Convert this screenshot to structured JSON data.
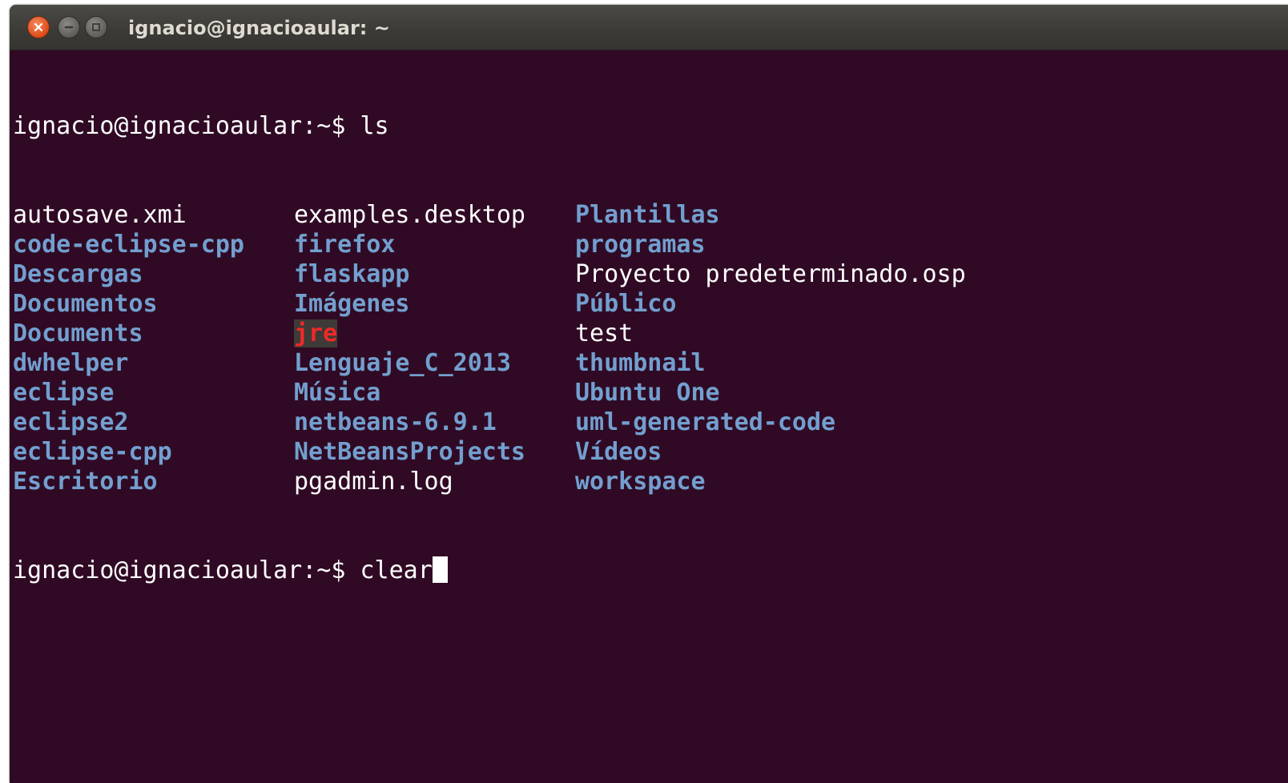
{
  "window": {
    "title": "ignacio@ignacioaular: ~",
    "controls": [
      {
        "name": "close",
        "icon": "close-icon",
        "symbol": "×"
      },
      {
        "name": "minimize",
        "icon": "minimize-icon",
        "symbol": "–"
      },
      {
        "name": "maximize",
        "icon": "maximize-icon",
        "symbol": "□"
      }
    ]
  },
  "colors": {
    "background": "#300a24",
    "directory": "#729fcf",
    "file": "#ffffff",
    "special": "#ef2929"
  },
  "terminal": {
    "prompt": "ignacio@ignacioaular:~$",
    "command1": "ls",
    "listing": [
      [
        {
          "text": "autosave.xmi",
          "type": "file"
        },
        {
          "text": "examples.desktop",
          "type": "file"
        },
        {
          "text": "Plantillas",
          "type": "dir"
        }
      ],
      [
        {
          "text": "code-eclipse-cpp",
          "type": "dir"
        },
        {
          "text": "firefox",
          "type": "dir"
        },
        {
          "text": "programas",
          "type": "dir"
        }
      ],
      [
        {
          "text": "Descargas",
          "type": "dir"
        },
        {
          "text": "flaskapp",
          "type": "dir"
        },
        {
          "text": "Proyecto predeterminado.osp",
          "type": "file"
        }
      ],
      [
        {
          "text": "Documentos",
          "type": "dir"
        },
        {
          "text": "Imágenes",
          "type": "dir"
        },
        {
          "text": "Público",
          "type": "dir"
        }
      ],
      [
        {
          "text": "Documents",
          "type": "dir"
        },
        {
          "text": "jre",
          "type": "special"
        },
        {
          "text": "test",
          "type": "file"
        }
      ],
      [
        {
          "text": "dwhelper",
          "type": "dir"
        },
        {
          "text": "Lenguaje_C_2013",
          "type": "dir"
        },
        {
          "text": "thumbnail",
          "type": "dir"
        }
      ],
      [
        {
          "text": "eclipse",
          "type": "dir"
        },
        {
          "text": "Música",
          "type": "dir"
        },
        {
          "text": "Ubuntu One",
          "type": "dir"
        }
      ],
      [
        {
          "text": "eclipse2",
          "type": "dir"
        },
        {
          "text": "netbeans-6.9.1",
          "type": "dir"
        },
        {
          "text": "uml-generated-code",
          "type": "dir"
        }
      ],
      [
        {
          "text": "eclipse-cpp",
          "type": "dir"
        },
        {
          "text": "NetBeansProjects",
          "type": "dir"
        },
        {
          "text": "Vídeos",
          "type": "dir"
        }
      ],
      [
        {
          "text": "Escritorio",
          "type": "dir"
        },
        {
          "text": "pgadmin.log",
          "type": "file"
        },
        {
          "text": "workspace",
          "type": "dir"
        }
      ]
    ],
    "command2": "clear"
  }
}
